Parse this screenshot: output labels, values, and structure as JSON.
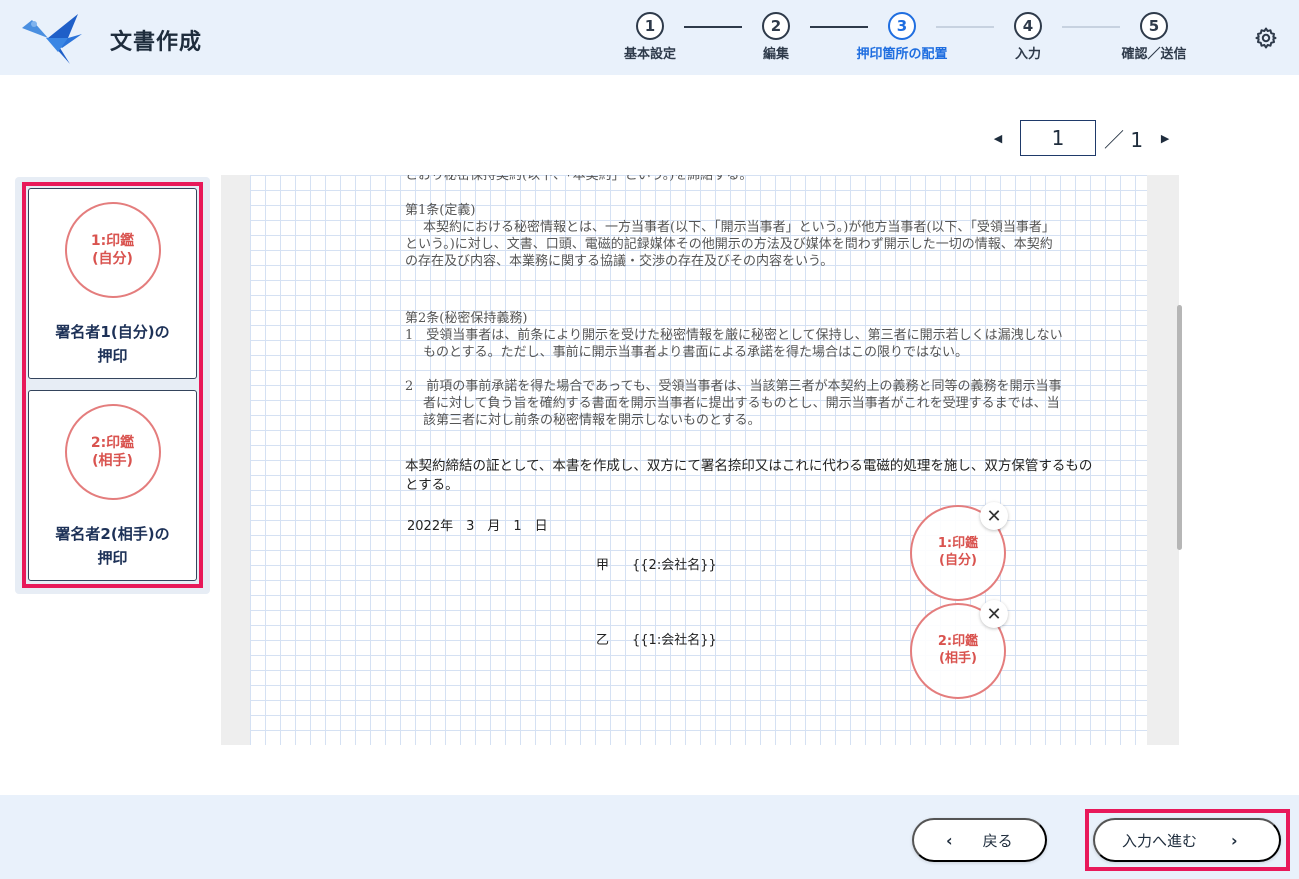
{
  "header": {
    "title": "文書作成",
    "steps": [
      {
        "number": "1",
        "label": "基本設定"
      },
      {
        "number": "2",
        "label": "編集"
      },
      {
        "number": "3",
        "label": "押印箇所の配置"
      },
      {
        "number": "4",
        "label": "入力"
      },
      {
        "number": "5",
        "label": "確認／送信"
      }
    ],
    "active_step": "3"
  },
  "pager": {
    "current_page": "1",
    "total": "／ 1"
  },
  "left_panel": {
    "cards": [
      {
        "stamp_line1": "1:印鑑",
        "stamp_line2": "(自分)",
        "label_line1": "署名者1(自分)の",
        "label_line2": "押印"
      },
      {
        "stamp_line1": "2:印鑑",
        "stamp_line2": "(相手)",
        "label_line1": "署名者2(相手)の",
        "label_line2": "押印"
      }
    ]
  },
  "document": {
    "cut_top": "とおり秘密保持契約(以下、「本契約」という。)を締結する。",
    "art1_title": "第1条(定義)",
    "art1_body": "本契約における秘密情報とは、一方当事者(以下、「開示当事者」という。)が他方当事者(以下、「受領当事者」という。)に対し、文書、口頭、電磁的記録媒体その他開示の方法及び媒体を問わず開示した一切の情報、本契約の存在及び内容、本業務に関する協議・交渉の存在及びその内容をいう。",
    "art2_title": "第2条(秘密保持義務)",
    "art2_item1": "1　受領当事者は、前条により開示を受けた秘密情報を厳に秘密として保持し、第三者に開示若しくは漏洩しないものとする。ただし、事前に開示当事者より書面による承諾を得た場合はこの限りではない。",
    "art2_item2": "2　前項の事前承諾を得た場合であっても、受領当事者は、当該第三者が本契約上の義務と同等の義務を開示当事者に対して負う旨を確約する書面を開示当事者に提出するものとし、開示当事者がこれを受理するまでは、当該第三者に対し前条の秘密情報を開示しないものとする。",
    "closing": "本契約締結の証として、本書を作成し、双方にて署名捺印又はこれに代わる電磁的処理を施し、双方保管するものとする。",
    "date": "2022年　3　月　1　日",
    "party_a_mark": "甲",
    "party_a_name": "{{2:会社名}}",
    "party_b_mark": "乙",
    "party_b_name": "{{1:会社名}}",
    "placed_stamps": [
      {
        "line1": "1:印鑑",
        "line2": "(自分)"
      },
      {
        "line1": "2:印鑑",
        "line2": "(相手)"
      }
    ],
    "close_symbol": "✕"
  },
  "footer": {
    "back_label": "戻る",
    "next_label": "入力へ進む"
  },
  "colors": {
    "accent": "#1f6ee0",
    "stamp": "#e47d7d",
    "highlight": "#e8195a",
    "header_bg": "#e9f1fb"
  },
  "icons": [
    "swallow-logo-icon",
    "gear-icon",
    "caret-left-icon",
    "caret-right-icon",
    "close-icon",
    "chevron-left-icon",
    "chevron-right-icon"
  ]
}
